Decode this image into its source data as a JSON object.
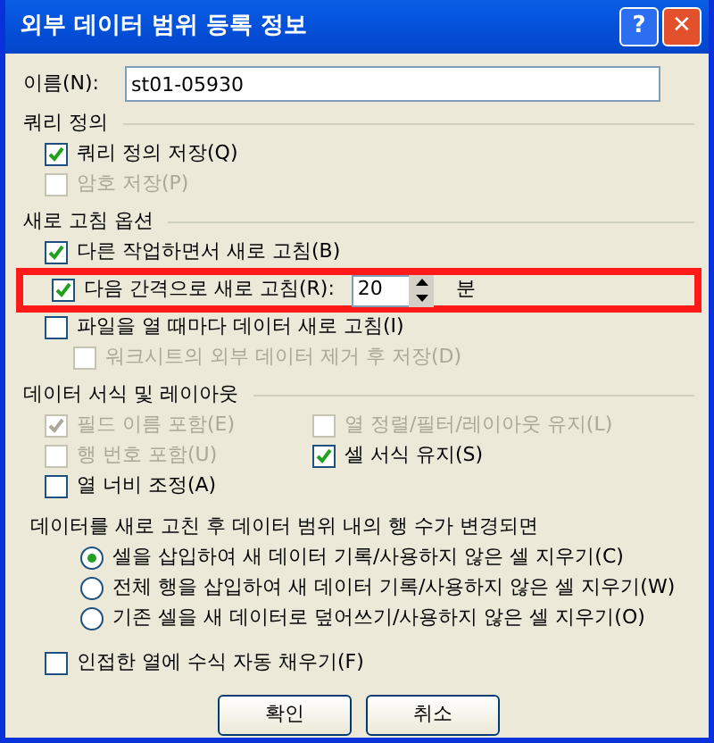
{
  "window": {
    "title": "외부 데이터 범위 등록 정보",
    "controls": [
      {
        "kind": "help",
        "label": "?"
      },
      {
        "kind": "close",
        "label": "✕"
      }
    ]
  },
  "name_field": {
    "label": "이름(N):",
    "value": "st01-05930"
  },
  "sections": [
    {
      "title": "쿼리 정의",
      "items": [
        {
          "kind": "checkbox",
          "label": "쿼리 정의 저장(Q)",
          "checked": true,
          "disabled": false
        },
        {
          "kind": "checkbox",
          "label": "암호 저장(P)",
          "checked": false,
          "disabled": true
        }
      ]
    },
    {
      "title": "새로 고침 옵션",
      "items": [
        {
          "kind": "checkbox",
          "label": "다른 작업하면서 새로 고침(B)",
          "checked": true,
          "disabled": false
        },
        {
          "kind": "interval",
          "label": "다음 간격으로 새로 고침(R):",
          "checked": true,
          "disabled": false,
          "value": "20",
          "unit": "분",
          "highlighted": true
        },
        {
          "kind": "checkbox",
          "label": "파일을 열 때마다 데이터 새로 고침(I)",
          "checked": false,
          "disabled": false,
          "children": [
            {
              "kind": "checkbox",
              "label": "워크시트의 외부 데이터 제거 후 저장(D)",
              "checked": false,
              "disabled": true
            }
          ]
        }
      ]
    },
    {
      "title": "데이터 서식 및 레이아웃",
      "kind": "two-column",
      "items": [
        {
          "kind": "checkbox",
          "label": "필드 이름 포함(E)",
          "checked": true,
          "disabled": true
        },
        {
          "kind": "checkbox",
          "label": "열 정렬/필터/레이아웃 유지(L)",
          "checked": false,
          "disabled": true
        },
        {
          "kind": "checkbox",
          "label": "행 번호 포함(U)",
          "checked": false,
          "disabled": true
        },
        {
          "kind": "checkbox",
          "label": "셀 서식 유지(S)",
          "checked": true,
          "disabled": false
        },
        {
          "kind": "checkbox",
          "label": "열 너비 조정(A)",
          "checked": false,
          "disabled": false
        }
      ]
    }
  ],
  "row_change": {
    "prompt": "데이터를 새로 고친 후 데이터 범위 내의 행 수가  변경되면",
    "options": [
      {
        "label": "셀을 삽입하여 새 데이터 기록/사용하지 않은 셀 지우기(C)",
        "selected": true
      },
      {
        "label": "전체 행을 삽입하여 새 데이터 기록/사용하지 않은 셀 지우기(W)",
        "selected": false
      },
      {
        "label": "기존 셀을 새 데이터로 덮어쓰기/사용하지 않은 셀 지우기(O)",
        "selected": false
      }
    ]
  },
  "fill_formulas": {
    "label": "인접한 열에 수식 자동 채우기(F)",
    "checked": false
  },
  "buttons": [
    "확인",
    "취소"
  ]
}
